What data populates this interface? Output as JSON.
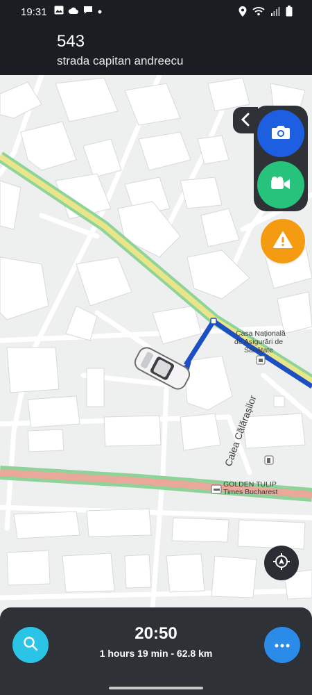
{
  "status_bar": {
    "time": "19:31",
    "left_icons": [
      "gallery-icon",
      "cloud-icon",
      "message-icon",
      "dot-icon"
    ],
    "right_icons": [
      "location-icon",
      "wifi-icon",
      "signal-icon",
      "battery-icon"
    ]
  },
  "header": {
    "house_number": "543",
    "street_name": "strada capitan andreecu"
  },
  "map": {
    "labels": {
      "poi_1_line1": "Casa Națională",
      "poi_1_line2": "de Asigurări de",
      "poi_1_line3": "Sănătate",
      "street": "Calea Călărașilor",
      "poi_2_line1": "GOLDEN TULIP",
      "poi_2_line2": "Times Bucharest"
    },
    "colors": {
      "route": "#1d4fc4",
      "main_road_yellow": "#e9e68a",
      "main_road_green": "#8fd39a",
      "salmon_road": "#eaa89a"
    }
  },
  "side_buttons": {
    "collapse_icon": "chevron-left-icon",
    "camera_icon": "camera-icon",
    "video_icon": "video-camera-icon",
    "warning_icon": "warning-icon",
    "locate_icon": "locate-icon"
  },
  "bottom_panel": {
    "eta": "20:50",
    "trip_summary": "1 hours 19 min - 62.8 km",
    "search_icon": "search-icon",
    "more_icon": "more-icon"
  }
}
